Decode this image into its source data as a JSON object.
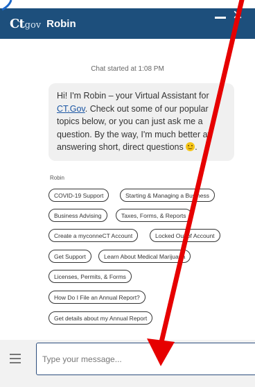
{
  "header": {
    "logo_ct": "Ct",
    "logo_gov": "gov",
    "agent_name": "Robin",
    "minimize_icon": "minimize-icon",
    "close_icon": "close-icon",
    "close_glyph": "×"
  },
  "chat": {
    "started_text": "Chat started at 1:08 PM",
    "greeting_prefix": "Hi! I'm Robin – your Virtual Assistant for ",
    "greeting_link": "CT.Gov",
    "greeting_suffix": ". Check out some of our popular topics below, or you can just ask me a question. By the way, I'm much better at answering short, direct questions ",
    "emoji_icon": "smiley-icon",
    "sender": "Robin"
  },
  "quick_replies": [
    "COVID-19 Support",
    "Starting & Managing a Business",
    "Business Advising",
    "Taxes, Forms, & Reports",
    "Create a myconneCT Account",
    "Locked Out of Account",
    "Get Support",
    "Learn About Medical Marijuana",
    "Licenses, Permits, & Forms",
    "How Do I File an Annual Report?",
    "Get details about my Annual Report"
  ],
  "composer": {
    "menu_icon": "hamburger-menu-icon",
    "placeholder": "Type your message..."
  },
  "colors": {
    "header_bg": "#1d4f7c",
    "link": "#1a55a3",
    "annotation_red": "#e60000"
  }
}
